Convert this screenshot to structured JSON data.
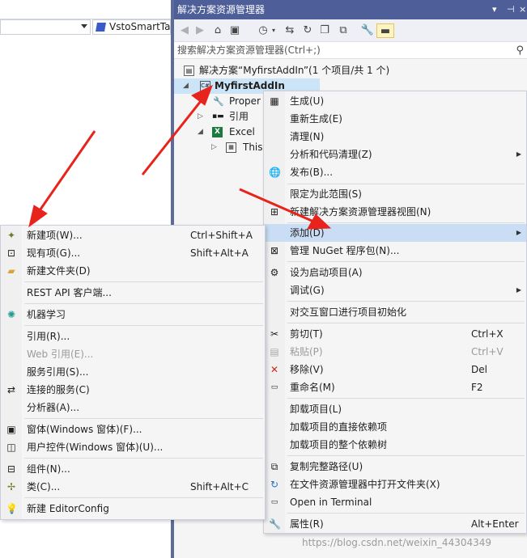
{
  "editor": {
    "member_combo": "VstoSmartTa"
  },
  "solution_explorer": {
    "title": "解决方案资源管理器",
    "title_controls": [
      "▾",
      "⊣",
      "×"
    ],
    "search_placeholder": "搜索解决方案资源管理器(Ctrl+;)",
    "tree": [
      {
        "label": "解决方案“MyfirstAddIn”(1 个项目/共 1 个)",
        "icon": "solution-icon"
      },
      {
        "label": "MyfirstAddIn",
        "icon": "csharp-project-icon",
        "bold": true,
        "selected": true,
        "expanded": true
      },
      {
        "label": "Proper",
        "icon": "wrench-icon"
      },
      {
        "label": "引用",
        "icon": "references-icon"
      },
      {
        "label": "Excel",
        "icon": "excel-icon",
        "expanded": true
      },
      {
        "label": "This",
        "icon": "sheet-icon"
      }
    ]
  },
  "project_menu": {
    "items": [
      {
        "label": "生成(U)",
        "icon": "build-icon"
      },
      {
        "label": "重新生成(E)"
      },
      {
        "label": "清理(N)"
      },
      {
        "label": "分析和代码清理(Z)",
        "submenu": true
      },
      {
        "label": "发布(B)...",
        "icon": "globe-icon"
      },
      {
        "label": "限定为此范围(S)"
      },
      {
        "label": "新建解决方案资源管理器视图(N)",
        "icon": "new-view-icon"
      },
      {
        "label": "添加(D)",
        "submenu": true,
        "highlighted": true
      },
      {
        "label": "管理 NuGet 程序包(N)...",
        "icon": "nuget-icon"
      },
      {
        "label": "设为启动项目(A)",
        "icon": "gear-icon"
      },
      {
        "label": "调试(G)",
        "submenu": true
      },
      {
        "label": "对交互窗口进行项目初始化"
      },
      {
        "label": "剪切(T)",
        "shortcut": "Ctrl+X",
        "icon": "scissors-icon"
      },
      {
        "label": "粘贴(P)",
        "shortcut": "Ctrl+V",
        "icon": "paste-icon",
        "disabled": true
      },
      {
        "label": "移除(V)",
        "shortcut": "Del",
        "icon": "remove-icon"
      },
      {
        "label": "重命名(M)",
        "shortcut": "F2",
        "icon": "rename-icon"
      },
      {
        "label": "卸载项目(L)"
      },
      {
        "label": "加载项目的直接依赖项"
      },
      {
        "label": "加载项目的整个依赖树"
      },
      {
        "label": "复制完整路径(U)",
        "icon": "copy-icon"
      },
      {
        "label": "在文件资源管理器中打开文件夹(X)",
        "icon": "refresh-icon"
      },
      {
        "label": "Open in Terminal",
        "icon": "terminal-icon"
      },
      {
        "label": "属性(R)",
        "shortcut": "Alt+Enter",
        "icon": "wrench-icon"
      }
    ]
  },
  "add_submenu": {
    "items": [
      {
        "label": "新建项(W)...",
        "shortcut": "Ctrl+Shift+A",
        "icon": "new-item-icon"
      },
      {
        "label": "现有项(G)...",
        "shortcut": "Shift+Alt+A",
        "icon": "existing-item-icon"
      },
      {
        "label": "新建文件夹(D)",
        "icon": "new-folder-icon"
      },
      {
        "label": "REST API 客户端..."
      },
      {
        "label": "机器学习",
        "icon": "ml-icon"
      },
      {
        "label": "引用(R)..."
      },
      {
        "label": "Web 引用(E)...",
        "disabled": true
      },
      {
        "label": "服务引用(S)..."
      },
      {
        "label": "连接的服务(C)",
        "icon": "connected-service-icon"
      },
      {
        "label": "分析器(A)..."
      },
      {
        "label": "窗体(Windows 窗体)(F)...",
        "icon": "form-icon"
      },
      {
        "label": "用户控件(Windows 窗体)(U)...",
        "icon": "user-control-icon"
      },
      {
        "label": "组件(N)...",
        "icon": "component-icon"
      },
      {
        "label": "类(C)...",
        "shortcut": "Shift+Alt+C",
        "icon": "class-icon"
      },
      {
        "label": "新建 EditorConfig",
        "icon": "lightbulb-icon"
      }
    ]
  },
  "watermark": "https://blog.csdn.net/weixin_44304349",
  "colors": {
    "title_bar": "#4d5e99",
    "highlight": "#c9def5",
    "selected": "#cce4f7",
    "arrow": "#e8231c"
  }
}
